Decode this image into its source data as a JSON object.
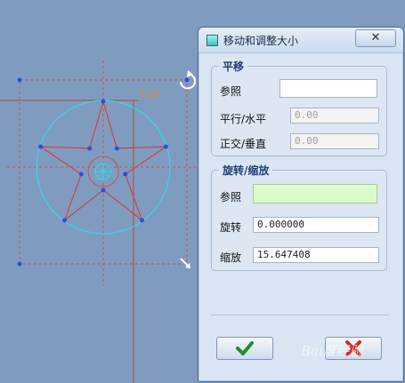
{
  "canvas": {
    "view_label": "TOP"
  },
  "dialog": {
    "title": "移动和调整大小",
    "close_symbol": "✕",
    "translate_group": {
      "title": "平移",
      "reference_label": "参照",
      "reference_value": "",
      "parallel_label": "平行/水平",
      "parallel_value": "0.00",
      "normal_label": "正交/垂直",
      "normal_value": "0.00"
    },
    "rotate_scale_group": {
      "title": "旋转/缩放",
      "reference_label": "参照",
      "reference_value": "",
      "rotate_label": "旋转",
      "rotate_value": "0.000000",
      "scale_label": "缩放",
      "scale_value": "15.647408"
    },
    "ok_icon": "checkmark-icon",
    "cancel_icon": "x-icon",
    "colors": {
      "ok_check": "#1e8f2e",
      "cancel_x": "#d42a1f",
      "reference_highlight": "#dbfbc8"
    }
  },
  "watermark": "Bai度经验"
}
